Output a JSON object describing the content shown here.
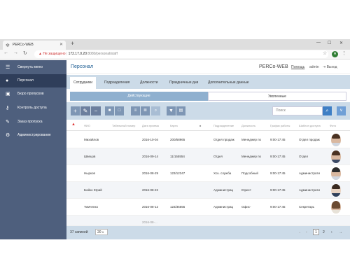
{
  "browser": {
    "tab_title": "PERCo-WEB",
    "url_warning": "Не защищено",
    "url_host": "172.17.0.20",
    "url_path": ":8080/personal/staff",
    "account_initial": "A"
  },
  "sidebar": {
    "items": [
      {
        "label": "Свернуть меню",
        "icon": "hamburger-icon"
      },
      {
        "label": "Персонал",
        "icon": "user-icon"
      },
      {
        "label": "Бюро пропусков",
        "icon": "user-card-icon"
      },
      {
        "label": "Контроль доступа",
        "icon": "key-icon"
      },
      {
        "label": "Заказ пропуска",
        "icon": "pass-order-icon"
      },
      {
        "label": "Администрирование",
        "icon": "gear-icon"
      }
    ]
  },
  "header": {
    "title": "Персонал",
    "brand": "PERCo-WEB",
    "help": "Помощь",
    "user": "admin",
    "logout": "Выход"
  },
  "tabs": [
    "Сотрудники",
    "Подразделения",
    "Должности",
    "Праздничные дни",
    "Дополнительные данные"
  ],
  "toggle": {
    "active": "Действующие",
    "dismissed": "Уволенные"
  },
  "search": {
    "placeholder": "Поиск"
  },
  "table": {
    "headers": [
      "ФИО",
      "Табельный номер",
      "Дата приема",
      "Карта",
      "Подразделение",
      "Должность",
      "График работы",
      "Шаблон доступа",
      "Фото"
    ],
    "rows": [
      [
        "Михайлов",
        "",
        "2016-10-04",
        "200/58965",
        "Отдел продаж",
        "Менеджер по",
        "9:00-17:45",
        "Отдел продаж"
      ],
      [
        "Швецов",
        "",
        "2016-09-14",
        "11/155554",
        "Отдел",
        "Менеджер по",
        "9:00-17:45",
        "Отдел"
      ],
      [
        "Нырков",
        "",
        "2016-08-29",
        "123/12347",
        "Хоз. служба",
        "Подсобный",
        "9:00-17:45",
        "Администрати"
      ],
      [
        "Бойко Юрий",
        "",
        "2016-08-22",
        "",
        "Администрац",
        "Юрист",
        "9:00-17:45",
        "Администрати"
      ],
      [
        "Тимченко",
        "",
        "2016-08-12",
        "123/35555",
        "Администрац",
        "Офис-",
        "9:00-17:45",
        "Секретарь"
      ],
      [
        "",
        "",
        "2016-08-...",
        "",
        "",
        "",
        "",
        ""
      ]
    ]
  },
  "footer": {
    "records": "37 записей",
    "page_size": "20",
    "pages": [
      "1",
      "2"
    ]
  }
}
